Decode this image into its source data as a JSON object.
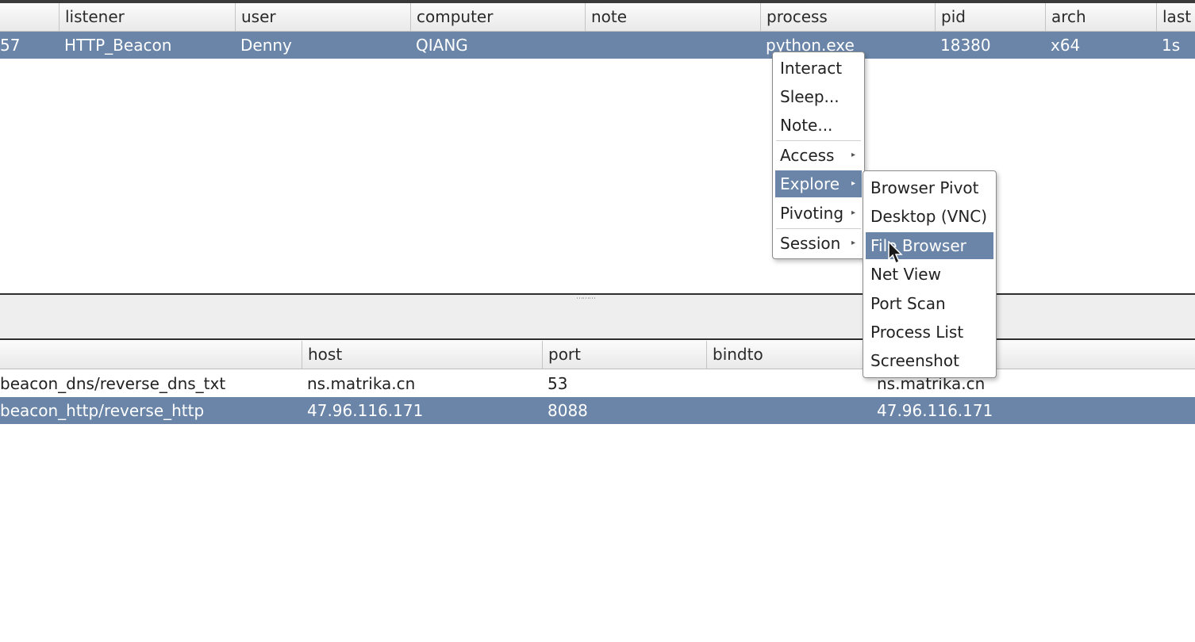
{
  "beacons_table": {
    "columns": {
      "listener": "listener",
      "user": "user",
      "computer": "computer",
      "note": "note",
      "process": "process",
      "pid": "pid",
      "arch": "arch",
      "last": "last"
    },
    "rows": [
      {
        "internal": "57",
        "listener": "HTTP_Beacon",
        "user": "Denny",
        "computer": "QIANG",
        "note": "",
        "process": "python.exe",
        "pid": "18380",
        "arch": "x64",
        "last": "1s"
      }
    ]
  },
  "context_menu": {
    "items": [
      "Interact",
      "Sleep...",
      "Note...",
      "Access",
      "Explore",
      "Pivoting",
      "Session"
    ],
    "active": "Explore"
  },
  "explore_submenu": {
    "items": [
      "Browser Pivot",
      "Desktop (VNC)",
      "File Browser",
      "Net View",
      "Port Scan",
      "Process List",
      "Screenshot"
    ],
    "active": "File Browser"
  },
  "listeners_table": {
    "columns": {
      "host": "host",
      "port": "port",
      "bindto": "bindto"
    },
    "rows": [
      {
        "payload": "beacon_dns/reverse_dns_txt",
        "host": "ns.matrika.cn",
        "port": "53",
        "bindto": "",
        "beacons": "ns.matrika.cn"
      },
      {
        "payload": "beacon_http/reverse_http",
        "host": "47.96.116.171",
        "port": "8088",
        "bindto": "",
        "beacons": "47.96.116.171"
      }
    ]
  },
  "colors": {
    "selection": "#6a85a8",
    "header_bg": "#efefef"
  }
}
